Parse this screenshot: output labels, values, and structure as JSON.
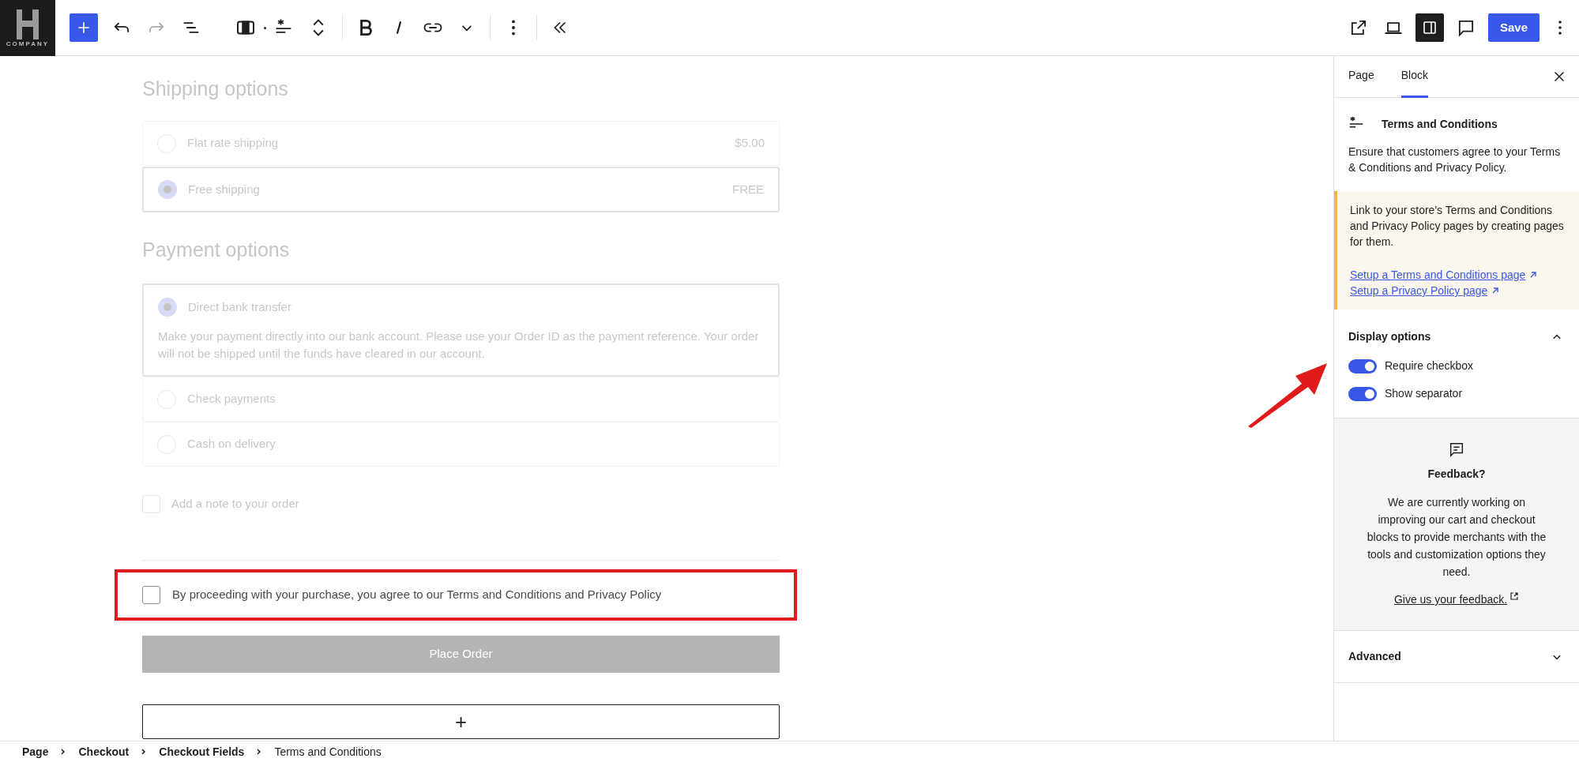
{
  "toolbar": {
    "logo": {
      "text": "COMPANY"
    },
    "sidebar_toggle": {
      "on": true
    },
    "save_button": "Save"
  },
  "checkout": {
    "shipping": {
      "heading": "Shipping options",
      "options": [
        {
          "label": "Flat rate shipping",
          "price": "$5.00",
          "selected": false
        },
        {
          "label": "Free shipping",
          "price": "FREE",
          "selected": true
        }
      ]
    },
    "payment": {
      "heading": "Payment options",
      "options": [
        {
          "label": "Direct bank transfer",
          "description": "Make your payment directly into our bank account. Please use your Order ID as the payment reference. Your order will not be shipped until the funds have cleared in our account.",
          "selected": true
        },
        {
          "label": "Check payments",
          "selected": false
        },
        {
          "label": "Cash on delivery",
          "selected": false
        }
      ]
    },
    "order_note": {
      "label": "Add a note to your order",
      "checked": false
    },
    "terms": {
      "text": "By proceeding with your purchase, you agree to our Terms and Conditions and Privacy Policy",
      "checked": false
    },
    "place_order": "Place Order",
    "add_block": "+"
  },
  "breadcrumb": [
    "Page",
    "Checkout",
    "Checkout Fields",
    "Terms and Conditions"
  ],
  "sidebar": {
    "tabs": [
      {
        "label": "Page",
        "selected": false
      },
      {
        "label": "Block",
        "selected": true
      }
    ],
    "block": {
      "title": "Terms and Conditions",
      "description": "Ensure that customers agree to your Terms & Conditions and Privacy Policy."
    },
    "notice": {
      "text": "Link to your store's Terms and Conditions and Privacy Policy pages by creating pages for them.",
      "links": [
        "Setup a Terms and Conditions page",
        "Setup a Privacy Policy page"
      ]
    },
    "display_options": {
      "title": "Display options",
      "expanded": true,
      "toggles": [
        {
          "label": "Require checkbox",
          "on": true
        },
        {
          "label": "Show separator",
          "on": true
        }
      ]
    },
    "feedback": {
      "title": "Feedback?",
      "text": "We are currently working on improving our cart and checkout blocks to provide merchants with the tools and customization options they need.",
      "link": "Give us your feedback."
    },
    "advanced": {
      "title": "Advanced",
      "expanded": false
    }
  }
}
